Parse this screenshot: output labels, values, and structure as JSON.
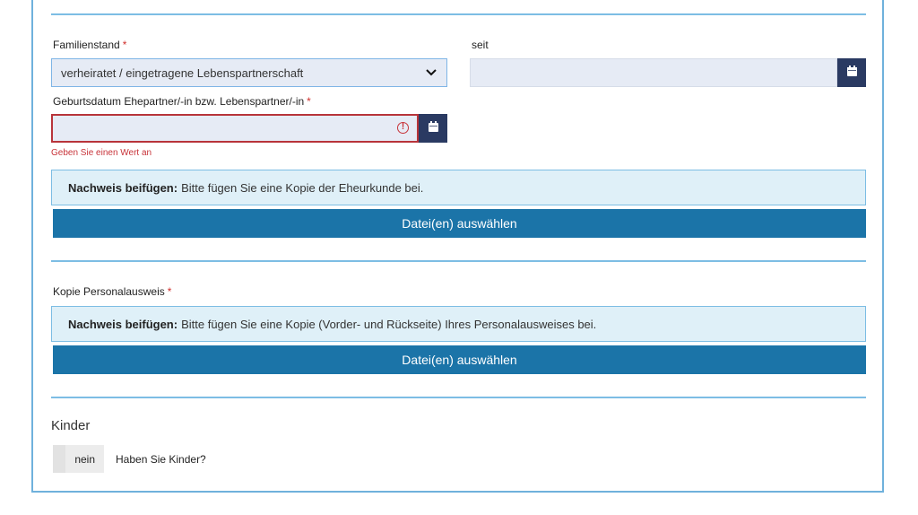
{
  "familienstand": {
    "label": "Familienstand",
    "required_marker": "*",
    "selected_value": "verheiratet / eingetragene Lebenspartnerschaft",
    "chevron_icon": "chevron-down-icon"
  },
  "seit": {
    "label": "seit",
    "value": "",
    "calendar_icon": "calendar-icon"
  },
  "geburtsdatum": {
    "label": "Geburtsdatum Ehepartner/-in bzw. Lebenspartner/-in",
    "required_marker": "*",
    "value": "",
    "error_icon": "error-icon",
    "error_icon_glyph": "!",
    "error_message": "Geben Sie einen Wert an",
    "calendar_icon": "calendar-icon"
  },
  "nachweis_eheurkunde": {
    "bold": "Nachweis beifügen:",
    "text": "Bitte fügen Sie eine Kopie der Eheurkunde bei.",
    "button_label": "Datei(en) auswählen"
  },
  "personalausweis": {
    "label": "Kopie Personalausweis",
    "required_marker": "*",
    "info_bold": "Nachweis beifügen:",
    "info_text": "Bitte fügen Sie eine Kopie (Vorder- und Rückseite) Ihres Personalausweises bei.",
    "button_label": "Datei(en) auswählen"
  },
  "kinder": {
    "title": "Kinder",
    "toggle_value": "nein",
    "question": "Haben Sie Kinder?"
  },
  "colors": {
    "accent": "#1b74a8",
    "calendar_button": "#2a3a62",
    "error": "#c8343a",
    "info_bg": "#dff0f8",
    "border": "#7cbde4"
  }
}
